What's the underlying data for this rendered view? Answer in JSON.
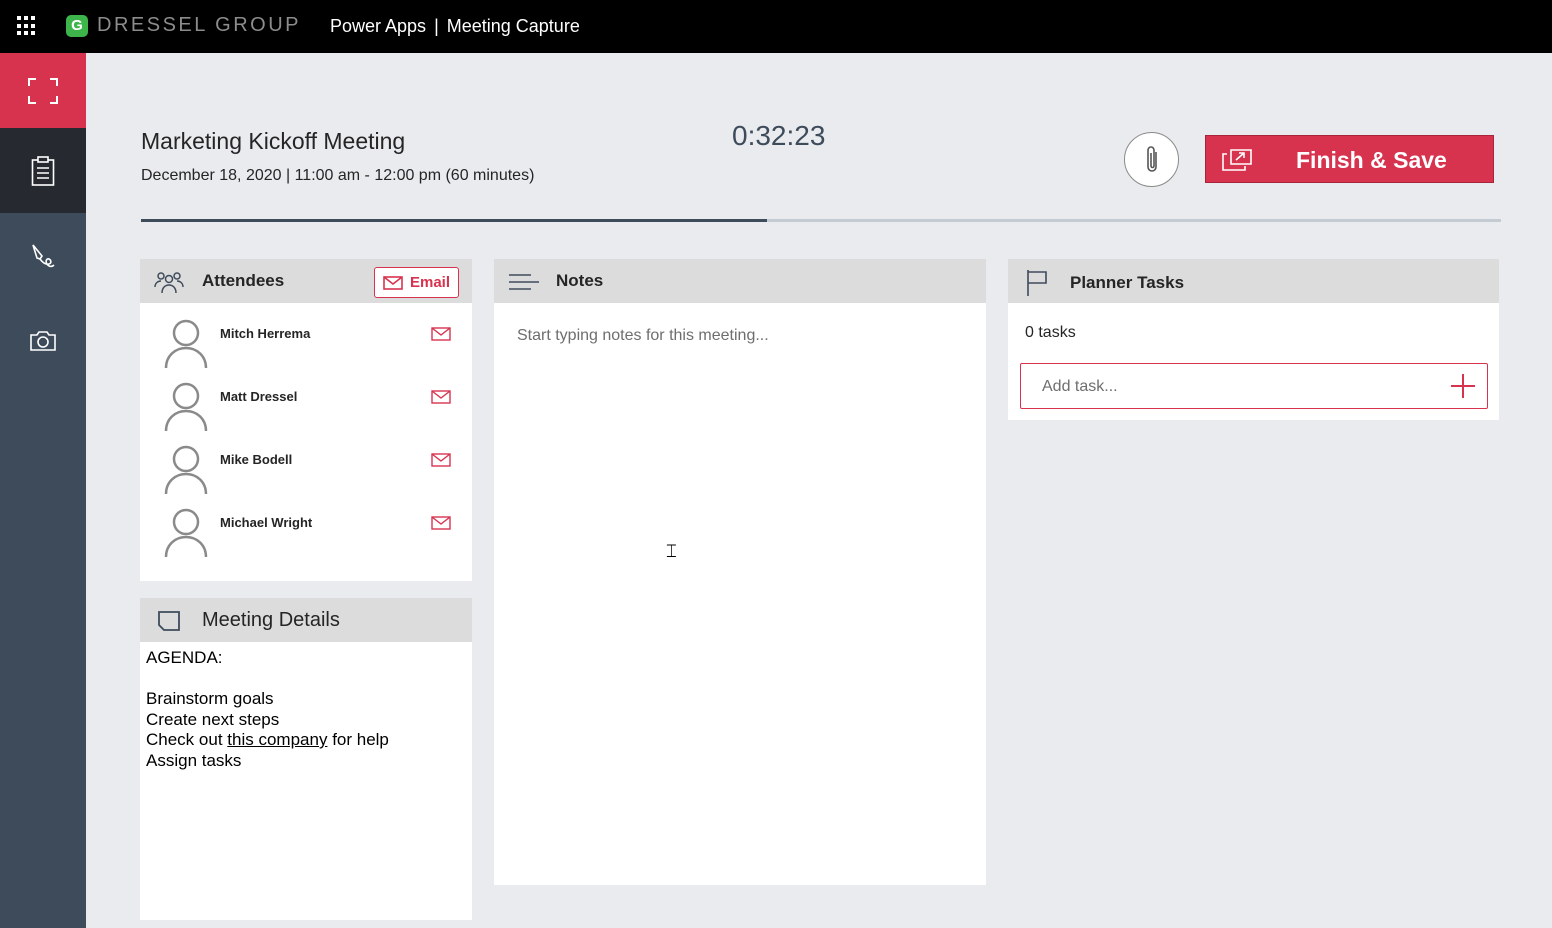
{
  "topbar": {
    "brand_logo": "G",
    "brand_name": "DRESSEL GROUP",
    "app": "Power Apps",
    "separator": "|",
    "screen": "Meeting Capture"
  },
  "rail": {
    "items": [
      {
        "icon": "expand-icon"
      },
      {
        "icon": "notes-icon"
      },
      {
        "icon": "pen-icon"
      },
      {
        "icon": "camera-icon"
      }
    ]
  },
  "header": {
    "title": "Marketing Kickoff Meeting",
    "datetime": "December 18, 2020 | 11:00 am - 12:00 pm (60 minutes)",
    "timer": "0:32:23",
    "finish_label": "Finish & Save",
    "progress": 0.46
  },
  "attendees": {
    "title": "Attendees",
    "email_label": "Email",
    "people": [
      {
        "name": "Mitch Herrema"
      },
      {
        "name": "Matt Dressel"
      },
      {
        "name": "Mike Bodell"
      },
      {
        "name": "Michael Wright"
      }
    ]
  },
  "details": {
    "title": "Meeting Details",
    "agenda_label": "AGENDA:",
    "line1": "Brainstorm goals",
    "line2": "Create next steps",
    "line3_pre": "Check out",
    "line3_link": "this company",
    "line3_post": "for help",
    "line4": "Assign tasks"
  },
  "notes": {
    "title": "Notes",
    "placeholder": "Start typing notes for this meeting..."
  },
  "tasks": {
    "title": "Planner Tasks",
    "count": "0 tasks",
    "placeholder": "Add task..."
  },
  "colors": {
    "accent": "#d7334f",
    "rail": "#3e4b5b",
    "rail_active": "#262a30",
    "brand_green": "#3db54a"
  }
}
